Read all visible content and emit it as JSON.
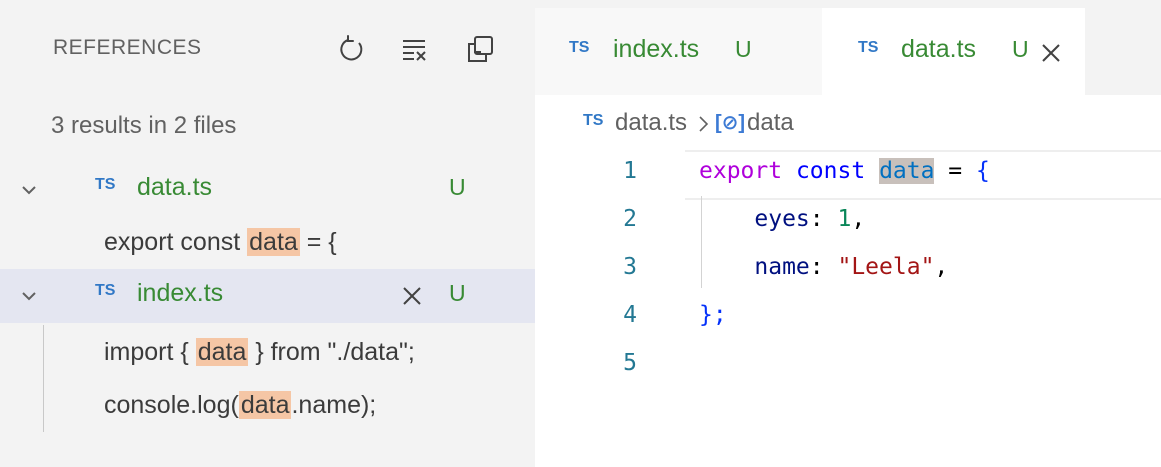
{
  "references": {
    "title": "REFERENCES",
    "actions": [
      "refresh-icon",
      "clear-results-icon",
      "collapse-all-icon"
    ],
    "summary": "3 results in 2 files",
    "files": [
      {
        "badge": "TS",
        "name": "data.ts",
        "status": "U",
        "matches": [
          {
            "before": "export const ",
            "match": "data",
            "after": " = {"
          }
        ]
      },
      {
        "badge": "TS",
        "name": "index.ts",
        "status": "U",
        "selected": true,
        "matches": [
          {
            "before": "import { ",
            "match": "data",
            "after": " } from \"./data\";"
          },
          {
            "before": "console.log(",
            "match": "data",
            "after": ".name);"
          }
        ]
      }
    ]
  },
  "tabs": [
    {
      "badge": "TS",
      "name": "index.ts",
      "status": "U",
      "active": false
    },
    {
      "badge": "TS",
      "name": "data.ts",
      "status": "U",
      "active": true
    }
  ],
  "breadcrumb": {
    "badge": "TS",
    "file": "data.ts",
    "symbol_icon": "[⊘]",
    "symbol": "data"
  },
  "editor": {
    "line_numbers": [
      "1",
      "2",
      "3",
      "4",
      "5"
    ],
    "lines": [
      {
        "kw1": "export",
        "kw2": "const",
        "ident": "data",
        "op": " = ",
        "brace": "{"
      },
      {
        "key": "eyes",
        "sep": ": ",
        "value": "1",
        "tail": ","
      },
      {
        "key": "name",
        "sep": ": ",
        "value": "\"Leela\"",
        "tail": ","
      },
      {
        "text": "};"
      },
      {
        "text": ""
      }
    ]
  },
  "colors": {
    "panel_bg": "#f3f3f3",
    "selection_bg": "#e4e6f1",
    "match_highlight": "#f5c6a5",
    "git_untracked": "#388a34",
    "ts_badge": "#3178c6"
  }
}
